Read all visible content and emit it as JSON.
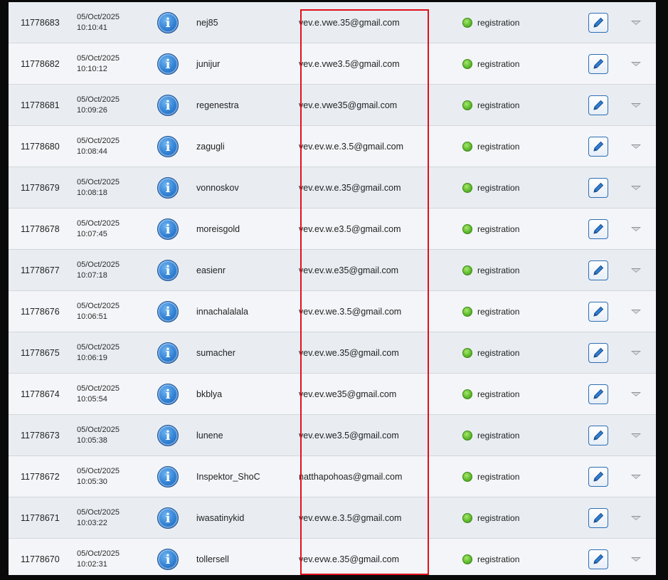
{
  "rows": [
    {
      "id": "11778683",
      "date": "05/Oct/2025",
      "time": "10:10:41",
      "username": "nej85",
      "email": "vev.e.vwe.35@gmail.com",
      "status": "registration"
    },
    {
      "id": "11778682",
      "date": "05/Oct/2025",
      "time": "10:10:12",
      "username": "junijur",
      "email": "vev.e.vwe3.5@gmail.com",
      "status": "registration"
    },
    {
      "id": "11778681",
      "date": "05/Oct/2025",
      "time": "10:09:26",
      "username": "regenestra",
      "email": "vev.e.vwe35@gmail.com",
      "status": "registration"
    },
    {
      "id": "11778680",
      "date": "05/Oct/2025",
      "time": "10:08:44",
      "username": "zagugli",
      "email": "vev.ev.w.e.3.5@gmail.com",
      "status": "registration"
    },
    {
      "id": "11778679",
      "date": "05/Oct/2025",
      "time": "10:08:18",
      "username": "vonnoskov",
      "email": "vev.ev.w.e.35@gmail.com",
      "status": "registration"
    },
    {
      "id": "11778678",
      "date": "05/Oct/2025",
      "time": "10:07:45",
      "username": "moreisgold",
      "email": "vev.ev.w.e3.5@gmail.com",
      "status": "registration"
    },
    {
      "id": "11778677",
      "date": "05/Oct/2025",
      "time": "10:07:18",
      "username": "easienr",
      "email": "vev.ev.w.e35@gmail.com",
      "status": "registration"
    },
    {
      "id": "11778676",
      "date": "05/Oct/2025",
      "time": "10:06:51",
      "username": "innachalalala",
      "email": "vev.ev.we.3.5@gmail.com",
      "status": "registration"
    },
    {
      "id": "11778675",
      "date": "05/Oct/2025",
      "time": "10:06:19",
      "username": "sumacher",
      "email": "vev.ev.we.35@gmail.com",
      "status": "registration"
    },
    {
      "id": "11778674",
      "date": "05/Oct/2025",
      "time": "10:05:54",
      "username": "bkblya",
      "email": "vev.ev.we35@gmail.com",
      "status": "registration"
    },
    {
      "id": "11778673",
      "date": "05/Oct/2025",
      "time": "10:05:38",
      "username": "lunene",
      "email": "vev.ev.we3.5@gmail.com",
      "status": "registration"
    },
    {
      "id": "11778672",
      "date": "05/Oct/2025",
      "time": "10:05:30",
      "username": "Inspektor_ShoC",
      "email": "natthapohoas@gmail.com",
      "status": "registration"
    },
    {
      "id": "11778671",
      "date": "05/Oct/2025",
      "time": "10:03:22",
      "username": "iwasatinykid",
      "email": "vev.evw.e.3.5@gmail.com",
      "status": "registration"
    },
    {
      "id": "11778670",
      "date": "05/Oct/2025",
      "time": "10:02:31",
      "username": "tollersell",
      "email": "vev.evw.e.35@gmail.com",
      "status": "registration"
    }
  ],
  "icons": {
    "info": "info-icon",
    "status": "status-dot-icon",
    "edit": "pencil-icon",
    "expand": "chevron-down-icon"
  },
  "colors": {
    "highlight": "#e0101a",
    "status_ok": "#5cb82a",
    "info_blue": "#2f7fd3"
  }
}
